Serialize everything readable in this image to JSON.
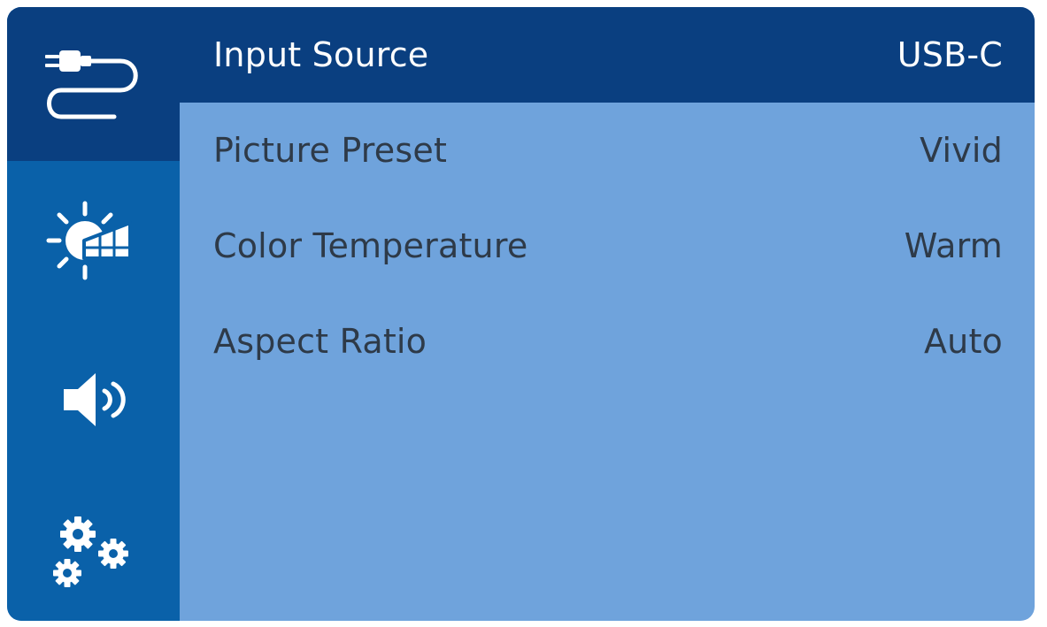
{
  "colors": {
    "sidebar_bg": "#0a61a9",
    "active_bg": "#0a3f80",
    "panel_bg": "#6fa3dc",
    "text": "#2e3a48",
    "active_text": "#ffffff"
  },
  "sidebar": {
    "items": [
      {
        "icon": "cable-icon",
        "selected": true
      },
      {
        "icon": "picture-brightness-icon",
        "selected": false
      },
      {
        "icon": "speaker-icon",
        "selected": false
      },
      {
        "icon": "gears-icon",
        "selected": false
      }
    ]
  },
  "menu": {
    "rows": [
      {
        "label": "Input Source",
        "value": "USB-C",
        "selected": true
      },
      {
        "label": "Picture Preset",
        "value": "Vivid",
        "selected": false
      },
      {
        "label": "Color Temperature",
        "value": "Warm",
        "selected": false
      },
      {
        "label": "Aspect Ratio",
        "value": "Auto",
        "selected": false
      }
    ]
  }
}
